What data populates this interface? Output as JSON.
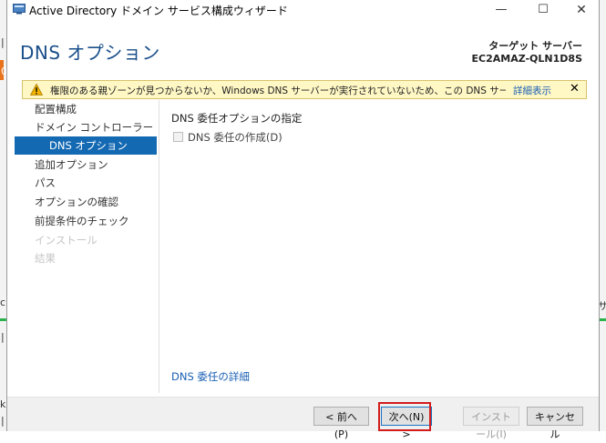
{
  "window": {
    "title": "Active Directory ドメイン サービス構成ウィザード",
    "minimize_glyph": "—",
    "maximize_glyph": "☐",
    "close_glyph": "✕"
  },
  "header": {
    "page_title": "DNS オプション",
    "target_label": "ターゲット サーバー",
    "target_value": "EC2AMAZ-QLN1D8S"
  },
  "warning": {
    "text": "権限のある親ゾーンが見つからないか、Windows DNS サーバーが実行されていないため、この DNS サーバーの委任を作成でき...",
    "link": "詳細表示",
    "close_glyph": "✕",
    "color": "#fff7c4"
  },
  "nav": {
    "items": [
      {
        "label": "配置構成",
        "state": "normal"
      },
      {
        "label": "ドメイン コントローラー オプション",
        "state": "normal"
      },
      {
        "label": "DNS オプション",
        "state": "active"
      },
      {
        "label": "追加オプション",
        "state": "normal"
      },
      {
        "label": "パス",
        "state": "normal"
      },
      {
        "label": "オプションの確認",
        "state": "normal"
      },
      {
        "label": "前提条件のチェック",
        "state": "normal"
      },
      {
        "label": "インストール",
        "state": "disabled"
      },
      {
        "label": "結果",
        "state": "disabled"
      }
    ]
  },
  "content": {
    "section_label": "DNS 委任オプションの指定",
    "checkbox_label": "DNS 委任の作成(D)",
    "checkbox_checked": false,
    "detail_link": "DNS 委任の詳細"
  },
  "footer": {
    "back": "< 前へ(P)",
    "next": "次へ(N) >",
    "install": "インストール(I)",
    "cancel": "キャンセル"
  },
  "background": {
    "left_chars": [
      "|",
      "0",
      "c",
      "|",
      "k",
      "|"
    ],
    "right_chars": [
      "サ"
    ]
  },
  "colors": {
    "accent": "#1469b3",
    "title": "#1a4f8a",
    "link": "#1a5fb4",
    "highlight_box": "#d21c1c"
  }
}
